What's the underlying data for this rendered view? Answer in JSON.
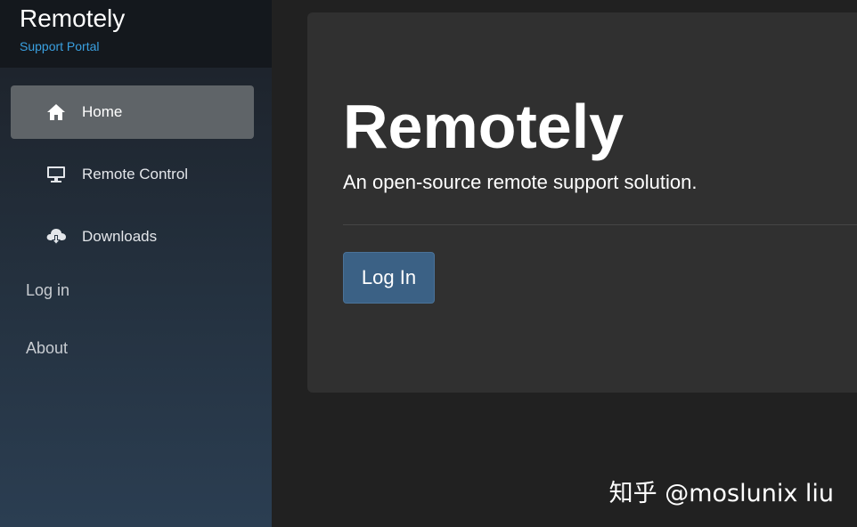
{
  "brand": {
    "title": "Remotely",
    "subtitle": "Support Portal"
  },
  "sidebar": {
    "items": [
      {
        "label": "Home",
        "icon": "home-icon",
        "active": true
      },
      {
        "label": "Remote Control",
        "icon": "monitor-icon",
        "active": false
      },
      {
        "label": "Downloads",
        "icon": "cloud-download-icon",
        "active": false
      }
    ],
    "login_label": "Log in",
    "about_label": "About"
  },
  "hero": {
    "title": "Remotely",
    "subtitle": "An open-source remote support solution.",
    "login_button": "Log In"
  },
  "watermark": "知乎 @moslunix liu",
  "colors": {
    "accent": "#3aa0e0",
    "button": "#3b6185",
    "sidebar_active": "#5f6468",
    "panel": "#303030",
    "background": "#212121"
  }
}
